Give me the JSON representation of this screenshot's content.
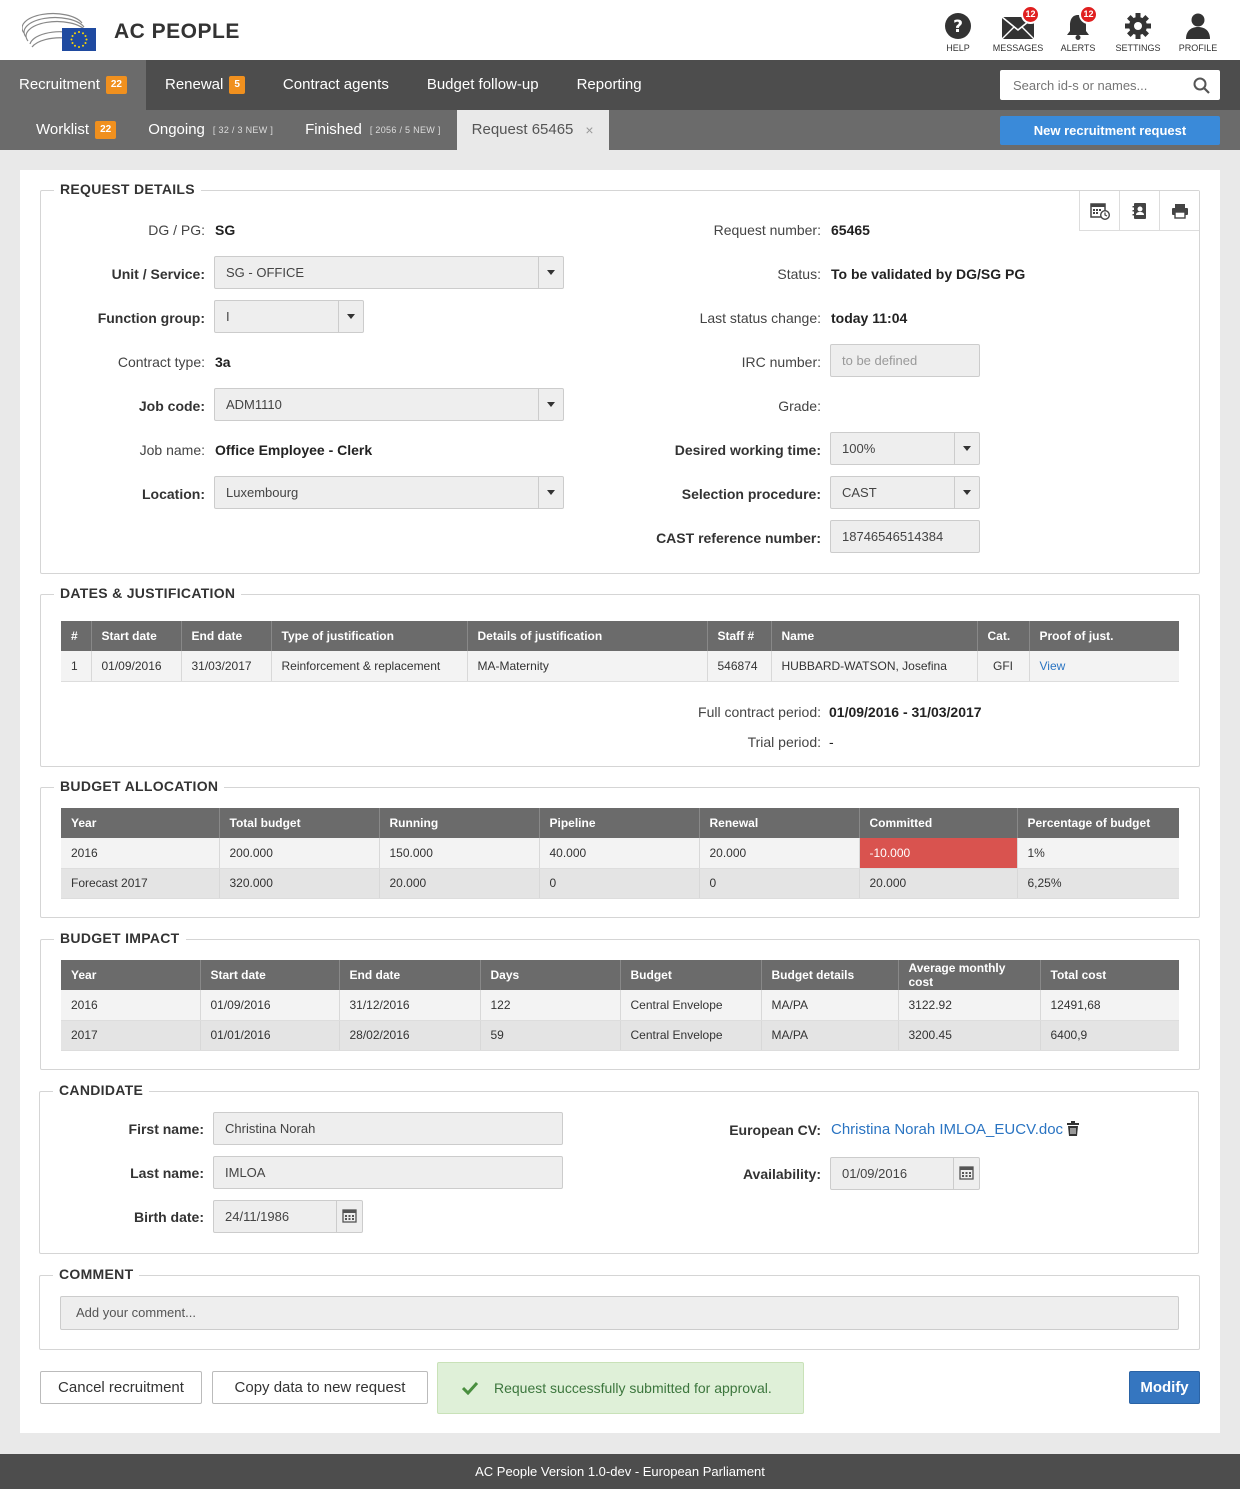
{
  "app": {
    "title": "AC PEOPLE"
  },
  "header_icons": [
    {
      "label": "HELP",
      "icon": "help-icon"
    },
    {
      "label": "MESSAGES",
      "icon": "envelope-icon",
      "badge": "12"
    },
    {
      "label": "ALERTS",
      "icon": "bell-icon",
      "badge": "12"
    },
    {
      "label": "SETTINGS",
      "icon": "gear-icon"
    },
    {
      "label": "PROFILE",
      "icon": "user-icon"
    }
  ],
  "nav": {
    "items": [
      {
        "label": "Recruitment",
        "badge": "22"
      },
      {
        "label": "Renewal",
        "badge": "5"
      },
      {
        "label": "Contract agents"
      },
      {
        "label": "Budget follow-up"
      },
      {
        "label": "Reporting"
      }
    ],
    "search_placeholder": "Search id-s or names..."
  },
  "subnav": {
    "worklist": {
      "label": "Worklist",
      "badge": "22"
    },
    "ongoing": {
      "label": "Ongoing",
      "sub": "[ 32 / 3 NEW ]"
    },
    "finished": {
      "label": "Finished",
      "sub": "[ 2056 / 5 NEW ]"
    },
    "request": {
      "label": "Request 65465",
      "close": "×"
    },
    "new_button": "New recruitment request"
  },
  "request_details": {
    "title": "REQUEST DETAILS",
    "dg_label": "DG / PG:",
    "dg_value": "SG",
    "unit_label": "Unit / Service:",
    "unit_value": "SG - OFFICE",
    "function_label": "Function group:",
    "function_value": "I",
    "contract_label": "Contract type:",
    "contract_value": "3a",
    "job_code_label": "Job code:",
    "job_code_value": "ADM1110",
    "job_name_label": "Job name:",
    "job_name_value": "Office Employee - Clerk",
    "location_label": "Location:",
    "location_value": "Luxembourg",
    "request_number_label": "Request number:",
    "request_number_value": "65465",
    "status_label": "Status:",
    "status_value": "To be validated by DG/SG PG",
    "last_change_label": "Last status change:",
    "last_change_value": "today 11:04",
    "irc_label": "IRC number:",
    "irc_placeholder": "to be defined",
    "grade_label": "Grade:",
    "working_time_label": "Desired working time:",
    "working_time_value": "100%",
    "selection_label": "Selection procedure:",
    "selection_value": "CAST",
    "cast_label": "CAST reference number:",
    "cast_value": "18746546514384"
  },
  "dates": {
    "title": "DATES & JUSTIFICATION",
    "headers": [
      "#",
      "Start date",
      "End date",
      "Type of justification",
      "Details of justification",
      "Staff #",
      "Name",
      "Cat.",
      "Proof of just."
    ],
    "rows": [
      [
        "1",
        "01/09/2016",
        "31/03/2017",
        "Reinforcement & replacement",
        "MA-Maternity",
        "546874",
        "HUBBARD-WATSON, Josefina",
        "GFI",
        "View"
      ]
    ],
    "full_period_label": "Full contract period:",
    "full_period_value": "01/09/2016 - 31/03/2017",
    "trial_label": "Trial period:",
    "trial_value": "-"
  },
  "budget_allocation": {
    "title": "BUDGET ALLOCATION",
    "headers": [
      "Year",
      "Total budget",
      "Running",
      "Pipeline",
      "Renewal",
      "Committed",
      "Percentage of budget"
    ],
    "rows": [
      [
        "2016",
        "200.000",
        "150.000",
        "40.000",
        "20.000",
        "-10.000",
        "1%"
      ],
      [
        "Forecast 2017",
        "320.000",
        "20.000",
        "0",
        "0",
        "20.000",
        "6,25%"
      ]
    ]
  },
  "budget_impact": {
    "title": "BUDGET IMPACT",
    "headers": [
      "Year",
      "Start date",
      "End date",
      "Days",
      "Budget",
      "Budget details",
      "Average monthly cost",
      "Total cost"
    ],
    "rows": [
      [
        "2016",
        "01/09/2016",
        "31/12/2016",
        "122",
        "Central Envelope",
        "MA/PA",
        "3122.92",
        "12491,68"
      ],
      [
        "2017",
        "01/01/2016",
        "28/02/2016",
        "59",
        "Central Envelope",
        "MA/PA",
        "3200.45",
        "6400,9"
      ]
    ]
  },
  "candidate": {
    "title": "CANDIDATE",
    "first_name_label": "First name:",
    "first_name_value": "Christina Norah",
    "last_name_label": "Last name:",
    "last_name_value": "IMLOA",
    "birth_label": "Birth date:",
    "birth_value": "24/11/1986",
    "cv_label": "European CV:",
    "cv_value": "Christina Norah IMLOA_EUCV.doc",
    "availability_label": "Availability:",
    "availability_value": "01/09/2016"
  },
  "comment": {
    "title": "COMMENT",
    "placeholder": "Add your comment..."
  },
  "actions": {
    "cancel": "Cancel recruitment",
    "copy": "Copy data to new request",
    "success": "Request successfully submitted for approval.",
    "modify": "Modify"
  },
  "footer": "AC People Version 1.0-dev - European Parliament",
  "colors": {
    "accent": "#3a8ad9",
    "badge": "#f0901e",
    "danger": "#d9534f",
    "nav": "#4d4d4d"
  }
}
